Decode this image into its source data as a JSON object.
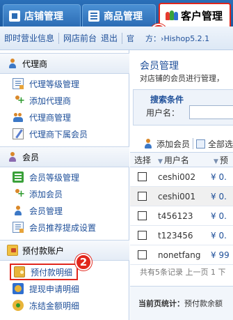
{
  "tabs": [
    {
      "label": "店铺管理",
      "icon": "store-icon"
    },
    {
      "label": "商品管理",
      "icon": "goods-icon"
    },
    {
      "label": "客户管理",
      "icon": "customers-icon",
      "active": true
    }
  ],
  "markers": {
    "one": "1",
    "two": "2"
  },
  "subbar": {
    "business_info": "即时营业信息",
    "storefront": "网店前台",
    "logout": "退出",
    "site_prefix": "官",
    "site_text": "方：›Hishop5.2.1"
  },
  "sidebar": {
    "sections": [
      {
        "title": "代理商",
        "icon": "agent-icon",
        "items": [
          {
            "label": "代理等级管理",
            "icon": "list-icon"
          },
          {
            "label": "添加代理商",
            "icon": "add-person-icon"
          },
          {
            "label": "代理商管理",
            "icon": "users-icon"
          },
          {
            "label": "代理商下属会员",
            "icon": "edit-icon"
          }
        ]
      },
      {
        "title": "会员",
        "icon": "member-icon",
        "items": [
          {
            "label": "会员等级管理",
            "icon": "list-icon"
          },
          {
            "label": "添加会员",
            "icon": "add-person-icon"
          },
          {
            "label": "会员管理",
            "icon": "users-icon"
          },
          {
            "label": "会员推荐提成设置",
            "icon": "edit-icon"
          }
        ]
      },
      {
        "title": "预付款账户",
        "icon": "folder-icon",
        "items": [
          {
            "label": "预付款明细",
            "icon": "wallet-icon",
            "highlighted": true
          },
          {
            "label": "提现申请明细",
            "icon": "withdraw-icon"
          },
          {
            "label": "冻结金额明细",
            "icon": "freeze-icon"
          }
        ]
      }
    ]
  },
  "main": {
    "title": "会员管理",
    "description": "对店铺的会员进行管理，",
    "search": {
      "caption": "搜索条件",
      "label": "用户名："
    },
    "toolbar": {
      "add": "添加会员",
      "select_all": "全部选"
    },
    "columns": [
      "选择",
      "用户名",
      "预"
    ],
    "rows": [
      {
        "username": "ceshi002",
        "amount": "¥ 0."
      },
      {
        "username": "ceshi001",
        "amount": "¥ 0."
      },
      {
        "username": "t456123",
        "amount": "¥ 0."
      },
      {
        "username": "t123456",
        "amount": "¥ 0."
      },
      {
        "username": "nonetfang",
        "amount": "¥ 99"
      }
    ],
    "pager": "共有5条记录 上一页 1 下",
    "stat_label": "当前页统计：",
    "stat_value": "预付款余额"
  }
}
